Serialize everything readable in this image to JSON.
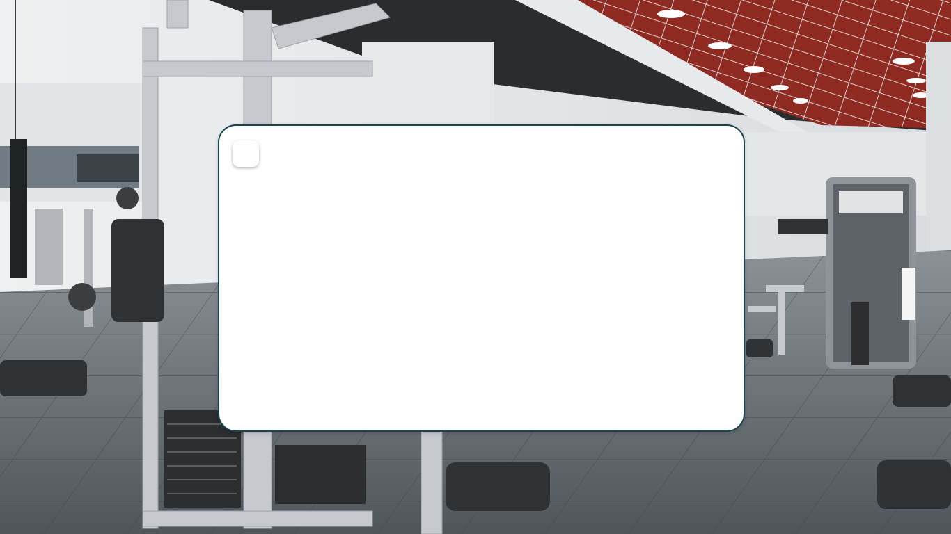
{
  "background": {
    "scene": "gym-interior-photo",
    "colors": {
      "ceiling": "#8f2a22",
      "floor": "#5d6469",
      "machine_frame": "#c9ccd0",
      "pad": "#2f3234"
    }
  },
  "modal": {
    "border_color": "#174650",
    "background": "#ffffff",
    "corner_button": {
      "icon": "blank-square-icon"
    }
  }
}
